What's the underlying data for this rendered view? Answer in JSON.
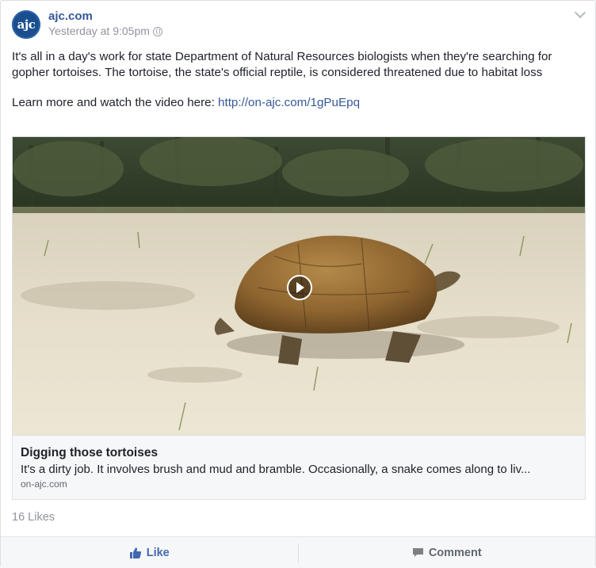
{
  "post": {
    "page_name": "ajc.com",
    "avatar_text": "ajc",
    "timestamp": "Yesterday at 9:05pm",
    "icons": {
      "privacy": "globe-icon",
      "options": "chevron-down-icon"
    },
    "text": "It's all in a day's work for state Department of Natural Resources biologists when they're searching for gopher tortoises. The tortoise, the state's official reptile, is considered threatened due to habitat loss",
    "link_prefix": "Learn more and watch the video here: ",
    "link_url": "http://on-ajc.com/1gPuEpq"
  },
  "attachment": {
    "title": "Digging those tortoises",
    "description": "It's a dirty job. It involves brush and mud and bramble. Occasionally, a snake comes along to liv...",
    "domain": "on-ajc.com",
    "icons": {
      "play": "play-icon"
    }
  },
  "engagement": {
    "likes": "16 Likes"
  },
  "actions": {
    "like_label": "Like",
    "comment_label": "Comment"
  },
  "colors": {
    "link": "#365899",
    "brand": "#4267b2",
    "muted": "#90949c",
    "avatar_bg": "#1a4e8f"
  }
}
